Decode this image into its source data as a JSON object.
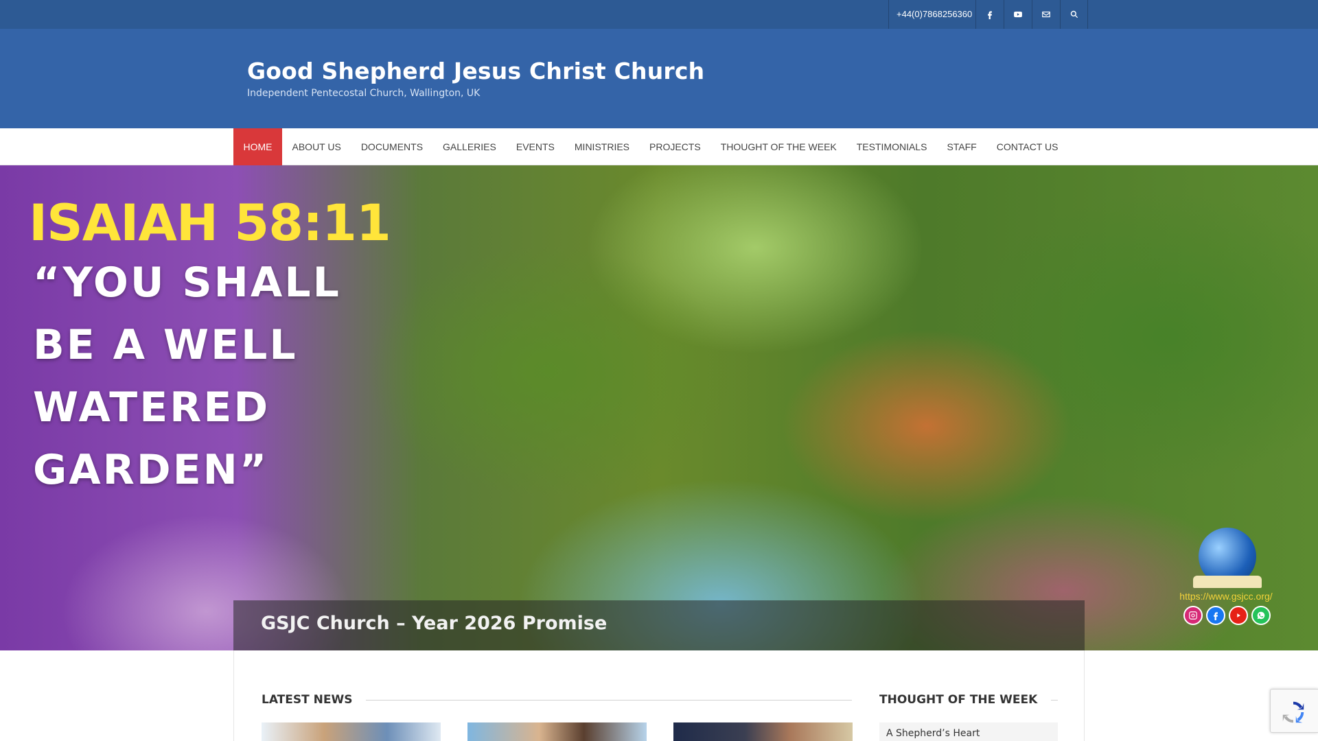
{
  "topbar": {
    "phone": "+44(0)7868256360",
    "icons": [
      "facebook-icon",
      "youtube-icon",
      "mail-icon",
      "search-icon"
    ]
  },
  "header": {
    "title": "Good Shepherd Jesus Christ Church",
    "tagline": "Independent Pentecostal Church, Wallington, UK"
  },
  "nav": {
    "items": [
      {
        "label": "HOME",
        "active": true
      },
      {
        "label": "ABOUT US",
        "active": false
      },
      {
        "label": "DOCUMENTS",
        "active": false
      },
      {
        "label": "GALLERIES",
        "active": false
      },
      {
        "label": "EVENTS",
        "active": false
      },
      {
        "label": "MINISTRIES",
        "active": false
      },
      {
        "label": "PROJECTS",
        "active": false
      },
      {
        "label": "THOUGHT OF THE WEEK",
        "active": false
      },
      {
        "label": "TESTIMONIALS",
        "active": false
      },
      {
        "label": "STAFF",
        "active": false
      },
      {
        "label": "CONTACT US",
        "active": false
      }
    ]
  },
  "hero": {
    "verse_ref": "ISAIAH 58:11",
    "verse_lines": [
      "“YOU SHALL",
      "BE A WELL",
      "WATERED",
      "GARDEN”"
    ],
    "caption": "GSJC Church – Year 2026 Promise",
    "brand_url": "https://www.gsjcc.org/",
    "brand_socials": [
      "instagram-icon",
      "facebook-icon",
      "youtube-icon",
      "whatsapp-icon"
    ]
  },
  "sections": {
    "latest_news": "LATEST NEWS",
    "thought_of_week": "THOUGHT OF THE WEEK",
    "thought_item": "A Shepherd’s Heart"
  },
  "colors": {
    "topbar": "#2d5a94",
    "header": "#3464a8",
    "nav_active": "#d9383a",
    "verse_ref": "#ffe53a",
    "brand_url": "#f3d23a"
  }
}
